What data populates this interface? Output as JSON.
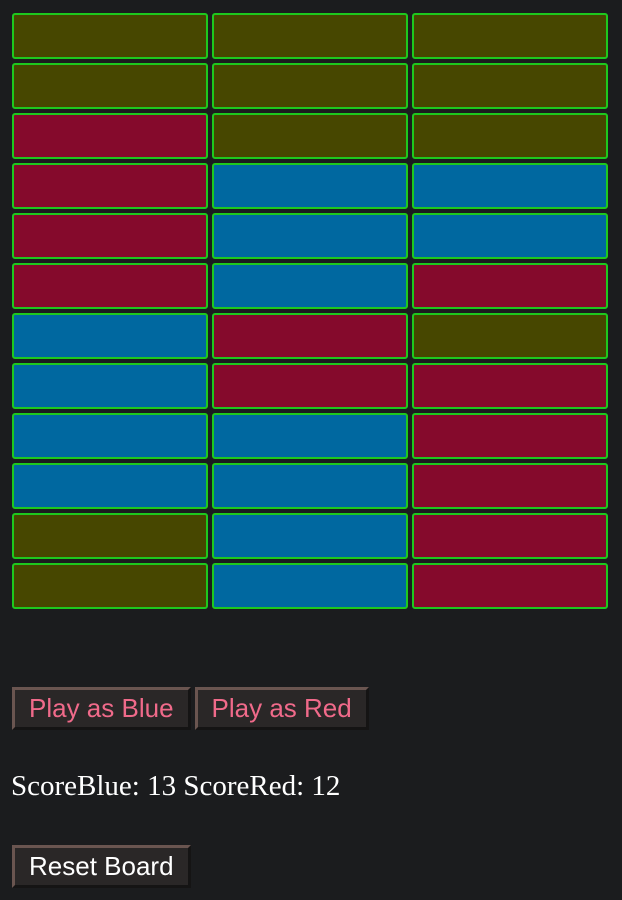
{
  "colors": {
    "olive": "#474700",
    "red": "#850a2c",
    "blue": "#0068a0",
    "cell_border": "#1ec81e",
    "background": "#1b1c1e"
  },
  "board": {
    "rows": [
      [
        "olive",
        "olive",
        "olive"
      ],
      [
        "olive",
        "olive",
        "olive"
      ],
      [
        "red",
        "olive",
        "olive"
      ],
      [
        "red",
        "blue",
        "blue"
      ],
      [
        "red",
        "blue",
        "blue"
      ],
      [
        "red",
        "blue",
        "red"
      ],
      [
        "blue",
        "red",
        "olive"
      ],
      [
        "blue",
        "red",
        "red"
      ],
      [
        "blue",
        "blue",
        "red"
      ],
      [
        "blue",
        "blue",
        "red"
      ],
      [
        "olive",
        "blue",
        "red"
      ],
      [
        "olive",
        "blue",
        "red"
      ]
    ]
  },
  "controls": {
    "play_blue_label": "Play as Blue",
    "play_red_label": "Play as Red",
    "reset_label": "Reset Board"
  },
  "score": {
    "blue_label": "ScoreBlue:",
    "blue_value": 13,
    "red_label": "ScoreRed:",
    "red_value": 12
  }
}
